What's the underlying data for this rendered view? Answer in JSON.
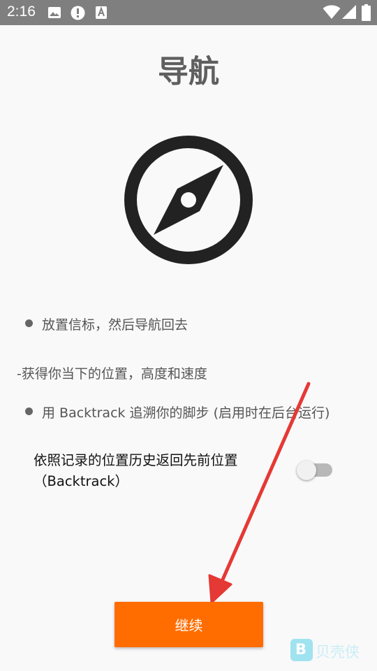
{
  "status_bar": {
    "time": "2:16",
    "left_icons": [
      "image-icon",
      "alert-icon",
      "font-icon"
    ],
    "right_icons": [
      "wifi-icon",
      "signal-icon",
      "battery-icon"
    ]
  },
  "page": {
    "title": "导航",
    "hero_icon": "compass-icon",
    "bullets": [
      "放置信标，然后导航回去",
      "-获得你当下的位置，高度和速度",
      "用 Backtrack 追溯你的脚步 (启用时在后台运行)"
    ],
    "toggle": {
      "label_line1": "依照记录的位置历史返回先前位置",
      "label_line2": "（Backtrack）",
      "enabled": false
    },
    "continue_label": "继续"
  },
  "watermark": {
    "logo_letter": "B",
    "text": "贝壳侠"
  },
  "colors": {
    "status_bar": "#7f7f7f",
    "accent": "#ff6d00",
    "arrow": "#e53935",
    "background": "#f9f9f9"
  }
}
